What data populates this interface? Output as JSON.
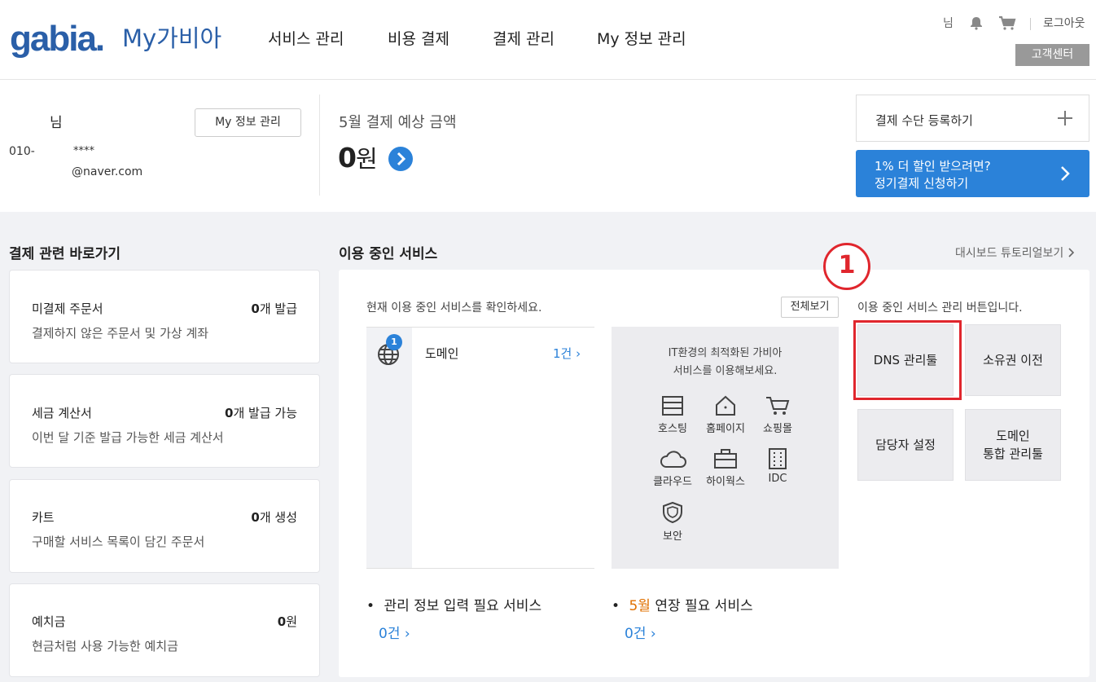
{
  "header": {
    "logo": "gabia.",
    "logo_sub": "My가비아",
    "nav": [
      "서비스 관리",
      "비용 결제",
      "결제 관리",
      "My 정보 관리"
    ],
    "user_suffix": "님",
    "logout": "로그아웃",
    "support": "고객센터"
  },
  "profile": {
    "name_suffix": "님",
    "phone": "010-",
    "phone_mask": "****",
    "email": "@naver.com",
    "my_info_button": "My 정보 관리"
  },
  "billing": {
    "label": "5월 결제 예상 금액",
    "amount": "0",
    "unit": "원"
  },
  "payment": {
    "register": "결제 수단 등록하기",
    "promo_line1": "1% 더 할인 받으려면?",
    "promo_line2": "정기결제 신청하기"
  },
  "shortcuts": {
    "title": "결제 관련 바로가기",
    "cards": [
      {
        "title": "미결제 주문서",
        "num": "0",
        "unit": "개 발급",
        "desc": "결제하지 않은 주문서 및 가상 계좌"
      },
      {
        "title": "세금 계산서",
        "num": "0",
        "unit": "개 발급 가능",
        "desc": "이번 달 기준 발급 가능한 세금 계산서"
      },
      {
        "title": "카트",
        "num": "0",
        "unit": "개 생성",
        "desc": "구매할 서비스 목록이 담긴 주문서"
      },
      {
        "title": "예치금",
        "num": "0",
        "unit": "원",
        "desc": "현금처럼 사용 가능한 예치금"
      }
    ]
  },
  "services": {
    "title": "이용 중인 서비스",
    "tutorial": "대시보드 튜토리얼보기",
    "hint": "현재 이용 중인 서비스를 확인하세요.",
    "view_all": "전체보기",
    "badge": "1",
    "domain_label": "도메인",
    "domain_count": "1건",
    "promo_line1": "IT환경의 최적화된 가비아",
    "promo_line2": "서비스를 이용해보세요.",
    "icons": [
      {
        "label": "호스팅",
        "icon": "server-icon"
      },
      {
        "label": "홈페이지",
        "icon": "home-icon"
      },
      {
        "label": "쇼핑몰",
        "icon": "cart-icon"
      },
      {
        "label": "클라우드",
        "icon": "cloud-icon"
      },
      {
        "label": "하이웍스",
        "icon": "briefcase-icon"
      },
      {
        "label": "IDC",
        "icon": "building-icon"
      },
      {
        "label": "보안",
        "icon": "shield-icon"
      }
    ],
    "needs_info_label": "관리 정보 입력 필요 서비스",
    "needs_info_count": "0건",
    "renew_month": "5월",
    "renew_label": "연장 필요 서비스",
    "renew_count": "0건",
    "annotation_number": "1",
    "manage_hint": "이용 중인 서비스 관리 버튼입니다.",
    "buttons": [
      "DNS 관리툴",
      "소유권 이전",
      "담당자 설정",
      "도메인\n통합 관리툴"
    ]
  },
  "colors": {
    "brand": "#2a5fa8",
    "accent": "#2b82d9",
    "highlight": "#e0262d",
    "orange": "#e07000"
  }
}
